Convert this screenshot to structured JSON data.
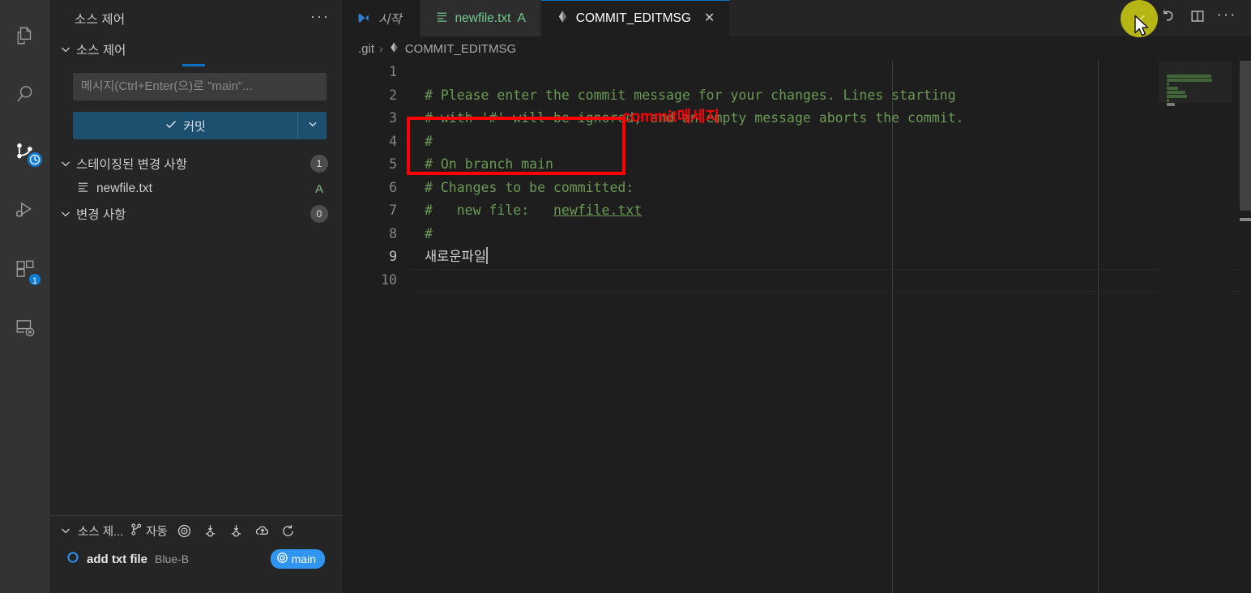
{
  "activity_bar": {
    "items": [
      {
        "name": "explorer",
        "icon": "files-icon",
        "badge": null
      },
      {
        "name": "search",
        "icon": "search-icon",
        "badge": null
      },
      {
        "name": "source-control",
        "icon": "source-control-icon",
        "badge": "clock"
      },
      {
        "name": "run-and-debug",
        "icon": "run-debug-icon",
        "badge": null
      },
      {
        "name": "extensions",
        "icon": "extensions-icon",
        "badge": "1"
      },
      {
        "name": "remote-explorer",
        "icon": "remote-explorer-icon",
        "badge": null
      }
    ]
  },
  "sidebar": {
    "title": "소스 제어",
    "more_actions": "···",
    "repo_section_label": "소스 제어",
    "commit_input": {
      "placeholder": "메시지(Ctrl+Enter(으)로 \"main\"...",
      "value": ""
    },
    "commit_button": {
      "label": "커밋",
      "check_icon": "check-icon",
      "dropdown_icon": "chevron-down-icon"
    },
    "groups": [
      {
        "label": "스테이징된 변경 사항",
        "count": "1",
        "files": [
          {
            "name": "newfile.txt",
            "status": "A",
            "icon": "text-file-icon"
          }
        ]
      },
      {
        "label": "변경 사항",
        "count": "0",
        "files": []
      }
    ]
  },
  "graph_panel": {
    "title": "소스 제...",
    "auto_label": "자동",
    "icons": [
      "branch-icon",
      "target-icon",
      "fetch-icon",
      "pull-icon",
      "push-cloud-icon",
      "refresh-icon"
    ],
    "commits": [
      {
        "message": "add txt file",
        "author": "Blue-B",
        "branch_chip": "main",
        "node_icon": "commit-circle-icon"
      }
    ]
  },
  "tabs": [
    {
      "label": "시작",
      "icon": "vscode-logo-icon",
      "state": "inactive",
      "italic": true
    },
    {
      "label": "newfile.txt",
      "icon": "text-file-icon",
      "status": "A",
      "state": "inactive",
      "color": "#73c991"
    },
    {
      "label": "COMMIT_EDITMSG",
      "icon": "git-file-icon",
      "state": "active",
      "close_icon": "close-icon"
    }
  ],
  "tab_actions": [
    {
      "name": "accept-commit-button",
      "icon": "check-icon",
      "highlighted": true
    },
    {
      "name": "discard-button",
      "icon": "undo-icon",
      "highlighted": false
    },
    {
      "name": "split-editor-button",
      "icon": "split-editor-icon",
      "highlighted": false
    },
    {
      "name": "more-actions-button",
      "icon": "ellipsis-icon",
      "highlighted": false
    }
  ],
  "breadcrumb": {
    "items": [
      "​.git",
      "COMMIT_EDITMSG"
    ],
    "separator": "›",
    "file_icon": "git-file-icon"
  },
  "editor": {
    "language": "git-commit",
    "lines": [
      {
        "num": "1",
        "text": ""
      },
      {
        "num": "2",
        "text": "# Please enter the commit message for your changes. Lines starting"
      },
      {
        "num": "3",
        "text": "# with '#' will be ignored, and an empty message aborts the commit."
      },
      {
        "num": "4",
        "text": "#"
      },
      {
        "num": "5",
        "text": "# On branch main"
      },
      {
        "num": "6",
        "text": "# Changes to be committed:"
      },
      {
        "num": "7",
        "text": "#\tnew file:   newfile.txt",
        "underlined_part": "newfile.txt"
      },
      {
        "num": "8",
        "text": "#"
      },
      {
        "num": "9",
        "text": "새로운파일",
        "current": true,
        "plain": true,
        "cursor": true
      },
      {
        "num": "10",
        "text": ""
      }
    ],
    "rulers": [
      1101,
      1355
    ],
    "colors": {
      "comment": "#6a9955",
      "text": "#d4d4d4",
      "background": "#1e1e1e",
      "line_number": "#858585"
    }
  },
  "annotations": [
    {
      "type": "red-rectangle",
      "target": "commit-message-line",
      "color": "#fb0007"
    },
    {
      "type": "red-label",
      "text": "commit메세지",
      "color": "#fb0007"
    }
  ],
  "mouse_cursor": {
    "visible": true,
    "over": "accept-commit-button"
  }
}
